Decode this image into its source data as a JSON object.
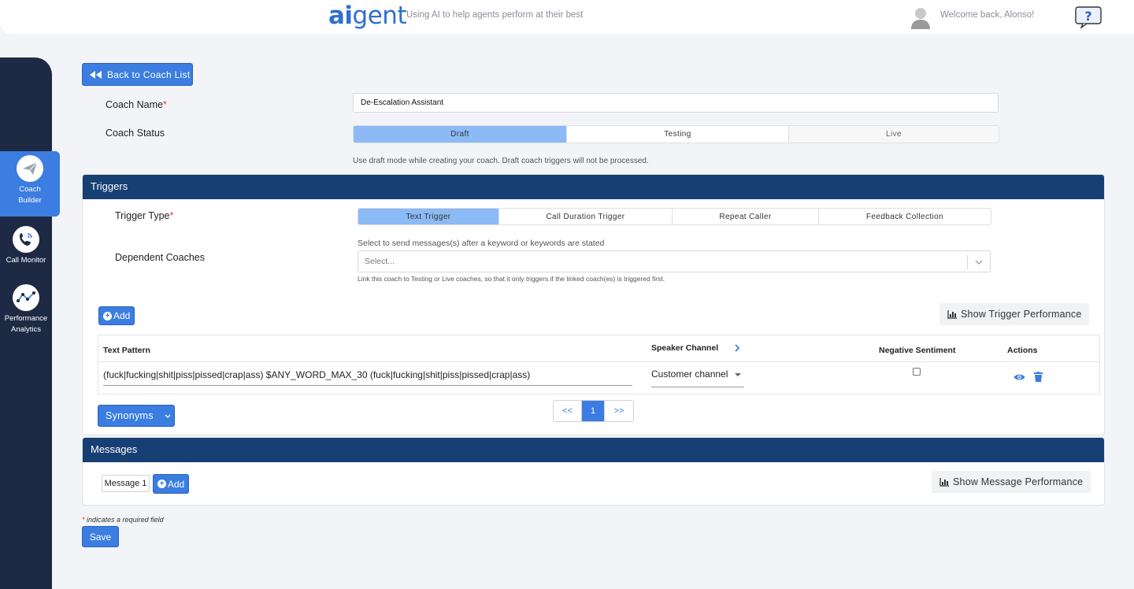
{
  "header": {
    "logo_ai": "ai",
    "logo_gent": "gent",
    "tagline": "Using AI to help agents perform at their best",
    "welcome": "Welcome back, Alonso!",
    "help_icon": "question-speech-bubble-icon"
  },
  "sidebar": {
    "items": [
      {
        "label_line1": "Coach",
        "label_line2": "Builder",
        "icon": "paper-plane-icon",
        "active": true
      },
      {
        "label_line1": "Call Monitor",
        "label_line2": "",
        "icon": "phone-icon",
        "active": false
      },
      {
        "label_line1": "Performance",
        "label_line2": "Analytics",
        "icon": "line-chart-icon",
        "active": false
      }
    ]
  },
  "back_button": {
    "label": "Back to Coach List",
    "icon": "double-left-arrow-icon"
  },
  "form": {
    "coach_name_label": "Coach Name",
    "coach_name_value": "De-Escalation Assistant",
    "coach_status_label": "Coach Status",
    "status_options": [
      "Draft",
      "Testing",
      "Live"
    ],
    "status_selected": "Draft",
    "status_hint": "Use draft mode while creating your coach. Draft coach triggers will not be processed.",
    "required_marker": "*"
  },
  "triggers": {
    "title": "Triggers",
    "trigger_type_label": "Trigger Type",
    "trigger_types": [
      "Text Trigger",
      "Call Duration Trigger",
      "Repeat Caller",
      "Feedback Collection"
    ],
    "trigger_selected": "Text Trigger",
    "trigger_hint": "Select to send messages(s) after a keyword or keywords are stated",
    "dependent_label": "Dependent Coaches",
    "dependent_placeholder": "Select...",
    "dependent_hint": "Link this coach to Testing or Live coaches, so that it only triggers if the linked coach(es) is triggered first.",
    "add_label": "Add",
    "show_performance_label": "Show Trigger Performance",
    "table": {
      "headers": {
        "text_pattern": "Text Pattern",
        "speaker_channel": "Speaker Channel",
        "negative_sentiment": "Negative Sentiment",
        "actions": "Actions"
      },
      "rows": [
        {
          "pattern": "(fuck|fucking|shit|piss|pissed|crap|ass) $ANY_WORD_MAX_30 (fuck|fucking|shit|piss|pissed|crap|ass)",
          "speaker_channel": "Customer channel",
          "negative_sentiment": false
        }
      ]
    },
    "pager": {
      "prev": "<<",
      "current": "1",
      "next": ">>"
    },
    "synonyms_label": "Synonyms"
  },
  "messages": {
    "title": "Messages",
    "tab_label": "Message 1",
    "add_label": "Add",
    "show_performance_label": "Show Message Performance"
  },
  "footer": {
    "required_note": "indicates a required field",
    "save_label": "Save"
  },
  "colors": {
    "primary": "#3b7de0",
    "navy": "#163f73",
    "sidebar": "#1e2a44",
    "selected_segment": "#8bbaf5",
    "required": "#e23b3b"
  }
}
